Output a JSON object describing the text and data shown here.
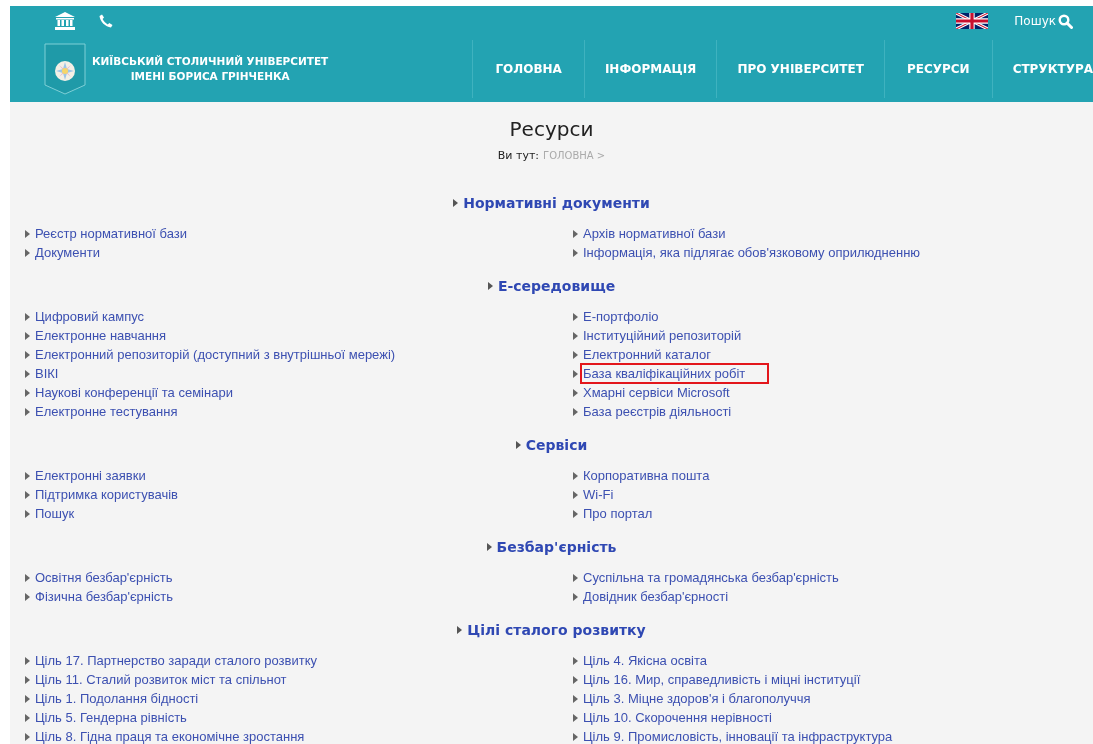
{
  "header": {
    "search_label": "Пошук",
    "university_name": [
      "КИЇВСЬКИЙ СТОЛИЧНИЙ УНІВЕРСИТЕТ",
      "ІМЕНІ БОРИСА ГРІНЧЕНКА"
    ],
    "nav": [
      {
        "label": "ГОЛОВНА",
        "selected": false
      },
      {
        "label": "ІНФОРМАЦІЯ",
        "selected": false
      },
      {
        "label": "ПРО УНІВЕРСИТЕТ",
        "selected": false
      },
      {
        "label": "РЕСУРСИ",
        "selected": false
      },
      {
        "label": "СТРУКТУРА",
        "selected": false
      }
    ]
  },
  "page": {
    "title": "Ресурси",
    "breadcrumb_label": "Ви тут:",
    "breadcrumb": "ГОЛОВНА >"
  },
  "sections": [
    {
      "heading": "Нормативні документи",
      "left": [
        {
          "label": "Реєстр нормативної бази",
          "highlighted": false
        },
        {
          "label": "Документи",
          "highlighted": false
        }
      ],
      "right": [
        {
          "label": "Архів нормативної бази",
          "highlighted": false
        },
        {
          "label": "Інформація, яка підлягає обов'язковому оприлюдненню",
          "highlighted": false
        }
      ]
    },
    {
      "heading": "Е-середовище",
      "left": [
        {
          "label": "Цифровий кампус",
          "highlighted": false
        },
        {
          "label": "Електронне навчання",
          "highlighted": false
        },
        {
          "label": "Електронний репозиторій (доступний з внутрішньої мережі)",
          "highlighted": false
        },
        {
          "label": "ВІКІ",
          "highlighted": false
        },
        {
          "label": "Наукові конференції та семінари",
          "highlighted": false
        },
        {
          "label": "Електронне тестування",
          "highlighted": false
        }
      ],
      "right": [
        {
          "label": "Е-портфоліо",
          "highlighted": false
        },
        {
          "label": "Інституційний репозиторій",
          "highlighted": false
        },
        {
          "label": "Електронний каталог",
          "highlighted": false
        },
        {
          "label": "База кваліфікаційних робіт",
          "highlighted": true
        },
        {
          "label": "Хмарні сервіси Microsoft",
          "highlighted": false
        },
        {
          "label": "База реєстрів діяльності",
          "highlighted": false
        }
      ]
    },
    {
      "heading": "Сервіси",
      "left": [
        {
          "label": "Електронні заявки",
          "highlighted": false
        },
        {
          "label": "Підтримка користувачів",
          "highlighted": false
        },
        {
          "label": "Пошук",
          "highlighted": false
        }
      ],
      "right": [
        {
          "label": "Корпоративна пошта",
          "highlighted": false
        },
        {
          "label": "Wi-Fi",
          "highlighted": false
        },
        {
          "label": "Про портал",
          "highlighted": false
        }
      ]
    },
    {
      "heading": "Безбар'єрність",
      "left": [
        {
          "label": "Освітня безбар'єрність",
          "highlighted": false
        },
        {
          "label": "Фізична безбар'єрність",
          "highlighted": false
        }
      ],
      "right": [
        {
          "label": "Суспільна та громадянська безбар'єрність",
          "highlighted": false
        },
        {
          "label": "Довідник безбар'єрності",
          "highlighted": false
        }
      ]
    },
    {
      "heading": "Цілі сталого розвитку",
      "left": [
        {
          "label": "Ціль 17. Партнерство заради сталого розвитку",
          "highlighted": false
        },
        {
          "label": "Ціль 11. Сталий розвиток міст та спільнот",
          "highlighted": false
        },
        {
          "label": "Ціль 1. Подолання бідності",
          "highlighted": false
        },
        {
          "label": "Ціль 5. Гендерна рівність",
          "highlighted": false
        },
        {
          "label": "Ціль 8. Гідна праця та економічне зростання",
          "highlighted": false
        }
      ],
      "right": [
        {
          "label": "Ціль 4. Якісна освіта",
          "highlighted": false
        },
        {
          "label": "Ціль 16. Мир, справедливість і міцні інституції",
          "highlighted": false
        },
        {
          "label": "Ціль 3. Міцне здоров'я і благополуччя",
          "highlighted": false
        },
        {
          "label": "Ціль 10. Скорочення нерівності",
          "highlighted": false
        },
        {
          "label": "Ціль 9. Промисловість, інновації та інфраструктура",
          "highlighted": false
        }
      ]
    }
  ]
}
